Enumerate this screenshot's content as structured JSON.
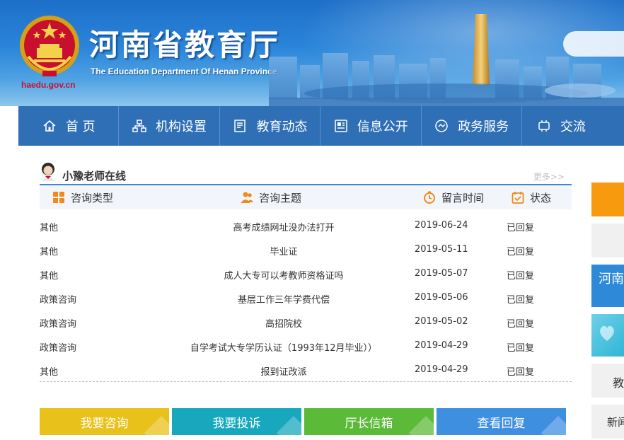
{
  "header": {
    "title": "河南省教育厅",
    "subtitle": "The Education Department Of Henan Province",
    "domain": "haedu.gov.cn"
  },
  "nav": {
    "items": [
      {
        "label": "首 页",
        "icon": "home-icon"
      },
      {
        "label": "机构设置",
        "icon": "org-icon"
      },
      {
        "label": "教育动态",
        "icon": "news-icon"
      },
      {
        "label": "信息公开",
        "icon": "info-icon"
      },
      {
        "label": "政务服务",
        "icon": "service-icon"
      },
      {
        "label": "交流",
        "icon": "exchange-icon"
      }
    ]
  },
  "panel": {
    "title": "小豫老师在线",
    "more": "更多>>",
    "columns": {
      "type": "咨询类型",
      "topic": "咨询主题",
      "time": "留言时间",
      "status": "状态"
    },
    "rows": [
      {
        "type": "其他",
        "topic": "高考成绩网址没办法打开",
        "date": "2019-06-24",
        "status": "已回复"
      },
      {
        "type": "其他",
        "topic": "毕业证",
        "date": "2019-05-11",
        "status": "已回复"
      },
      {
        "type": "其他",
        "topic": "成人大专可以考教师资格证吗",
        "date": "2019-05-07",
        "status": "已回复"
      },
      {
        "type": "政策咨询",
        "topic": "基层工作三年学费代偿",
        "date": "2019-05-06",
        "status": "已回复"
      },
      {
        "type": "政策咨询",
        "topic": "高招院校",
        "date": "2019-05-02",
        "status": "已回复"
      },
      {
        "type": "政策咨询",
        "topic": "自学考试大专学历认证（1993年12月毕业））",
        "date": "2019-04-29",
        "status": "已回复"
      },
      {
        "type": "其他",
        "topic": "报到证改派",
        "date": "2019-04-29",
        "status": "已回复"
      }
    ]
  },
  "actions": [
    {
      "label": "我要咨询",
      "color": "#e8c21a"
    },
    {
      "label": "我要投诉",
      "color": "#17a8bd"
    },
    {
      "label": "厅长信箱",
      "color": "#5cba39"
    },
    {
      "label": "查看回复",
      "color": "#3e8fe0"
    }
  ],
  "sidebar": {
    "items": [
      "河南",
      "教",
      "新闻"
    ]
  },
  "colors": {
    "nav_bg": "#2f6fb6",
    "accent_orange": "#f08a1a",
    "title_rule": "#3f87d2"
  }
}
